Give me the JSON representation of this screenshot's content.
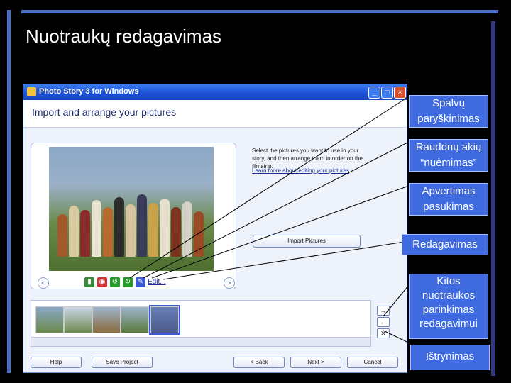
{
  "slide": {
    "title": "Nuotraukų redagavimas"
  },
  "window": {
    "title": "Photo Story 3 for Windows",
    "controls": {
      "minimize": "_",
      "maximize": "□",
      "close": "×"
    },
    "header": "Import and arrange your pictures",
    "instructions": "Select the pictures you want to use in your story, and then arrange them in order on the filmstrip.",
    "learn_more": "Learn more about editing your pictures",
    "import_button": "Import Pictures",
    "edit_link": "Edit...",
    "nav": {
      "prev": "<",
      "next": ">"
    },
    "strip_side_buttons": {
      "up": "→",
      "left": "←",
      "delete": "✕"
    },
    "footer": {
      "help": "Help",
      "save": "Save Project",
      "back": "< Back",
      "next": "Next >",
      "cancel": "Cancel"
    },
    "tool_icons": [
      "color-correct-icon",
      "red-eye-icon",
      "rotate-left-icon",
      "rotate-right-icon",
      "edit-icon"
    ]
  },
  "callouts": [
    "Spalvų paryškinimas",
    "Raudonų akių “nuėmimas”",
    "Apvertimas pasukimas",
    "Redagavimas",
    "Kitos nuotraukos parinkimas redagavimui",
    "Ištrynimas"
  ],
  "colors": {
    "accent": "#3f6ae0",
    "titlebar": "#1b4fd4",
    "slide_bg": "#000000"
  }
}
